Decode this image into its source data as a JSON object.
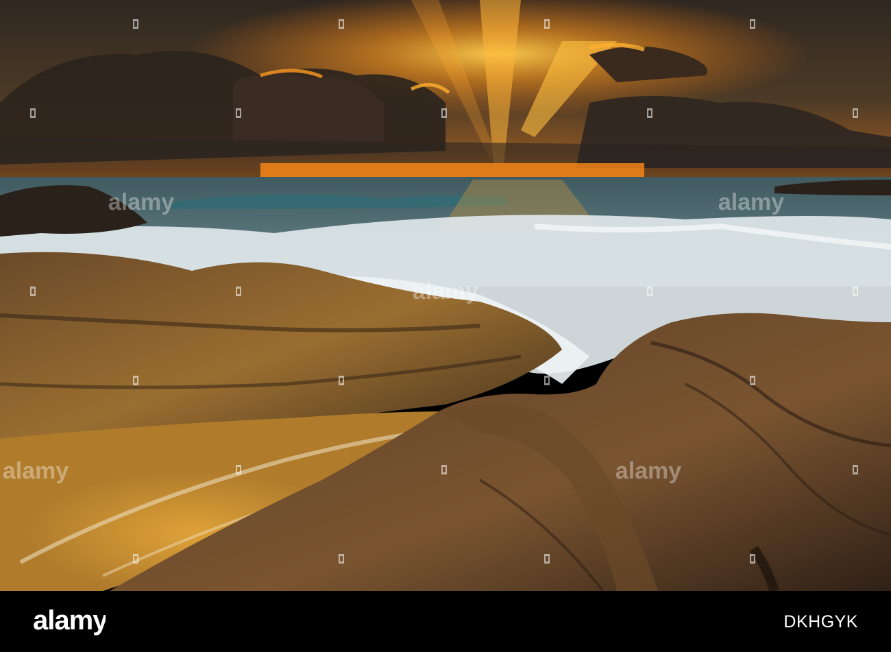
{
  "photo": {
    "subject": "Waves washing over rocky shore at sunset",
    "colors": {
      "sky_top": "#3a2e24",
      "sun_glow": "#ffb020",
      "horizon": "#ff8c1a",
      "sea": "#4a6b70",
      "foam": "#e6ecef",
      "rock_dark": "#3a2a1c",
      "rock_mid": "#7a5830",
      "rock_light": "#b8862e"
    }
  },
  "footer": {
    "logo_text": "alamy",
    "image_id": "DKHGYK"
  },
  "watermark": {
    "text": "alamy",
    "icon": "alamy-a-icon",
    "color": "#ffffff"
  }
}
